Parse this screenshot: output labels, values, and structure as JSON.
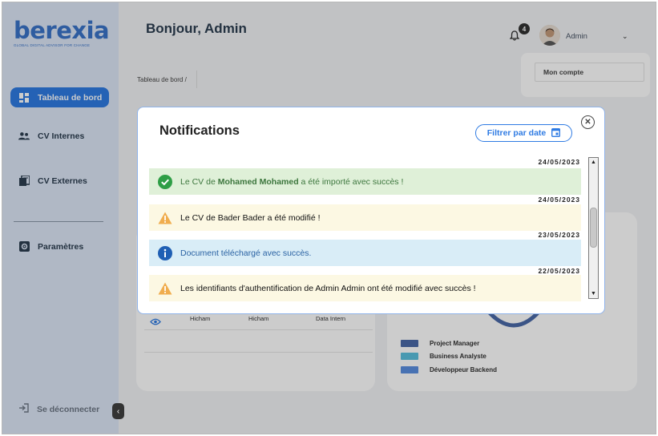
{
  "brand": {
    "name": "berexia",
    "tagline": "GLOBAL DIGITAL ADVISOR FOR CHANGE",
    "color": "#3a74c9"
  },
  "sidebar": {
    "items": [
      {
        "label": "Tableau de bord",
        "icon": "dashboard-icon",
        "active": true
      },
      {
        "label": "CV Internes",
        "icon": "users-icon",
        "active": false
      },
      {
        "label": "CV Externes",
        "icon": "documents-icon",
        "active": false
      },
      {
        "label": "Paramètres",
        "icon": "gear-icon",
        "active": false
      }
    ],
    "logout_label": "Se déconnecter",
    "collapse_icon": "chevron-left-icon"
  },
  "header": {
    "greeting": "Bonjour, Admin",
    "notification_count": "4",
    "user_name": "Admin",
    "dropdown_item": "Mon compte"
  },
  "breadcrumb": "Tableau de bord  /",
  "background_table": {
    "row": {
      "col1": "Hicham",
      "col2": "Hicham",
      "col3": "Data Intern"
    }
  },
  "legend": [
    {
      "label": "Project Manager",
      "color": "#4a6aa8"
    },
    {
      "label": "Business Analyste",
      "color": "#5bc0de"
    },
    {
      "label": "Développeur Backend",
      "color": "#5b8fe0"
    }
  ],
  "modal": {
    "title": "Notifications",
    "filter_label": "Filtrer par date",
    "close_icon": "close-icon",
    "notifications": [
      {
        "date": "24/05/2023",
        "type": "success",
        "pre": "Le CV de ",
        "strong": "Mohamed Mohamed",
        "post": " a été importé avec succès !"
      },
      {
        "date": "24/05/2023",
        "type": "warning",
        "pre": "Le CV de Bader Bader a été modifié !",
        "strong": "",
        "post": ""
      },
      {
        "date": "23/05/2023",
        "type": "info",
        "pre": "Document téléchargé avec succès.",
        "strong": "",
        "post": ""
      },
      {
        "date": "22/05/2023",
        "type": "warning",
        "pre": "Les identifiants d'authentification de Admin Admin ont été modifié avec succès !",
        "strong": "",
        "post": ""
      }
    ]
  }
}
